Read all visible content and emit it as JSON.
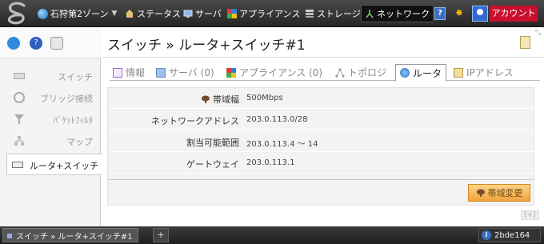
{
  "header": {
    "zone": "石狩第2ゾーン",
    "nav": [
      "ステータス",
      "サーバ",
      "アプライアンス",
      "ストレージ",
      "ネットワーク"
    ],
    "help": "?",
    "account": "アカウント"
  },
  "sidebar": {
    "items": [
      {
        "label": "スイッチ"
      },
      {
        "label": "ブリッジ接続"
      },
      {
        "label": "ﾊﾟｹｯﾄﾌｨﾙﾀ"
      },
      {
        "label": "マップ"
      },
      {
        "label": "ルータ+スイッチ"
      }
    ]
  },
  "main": {
    "title": "スイッチ » ルータ+スイッチ#1",
    "tabs": [
      {
        "label": "情報"
      },
      {
        "label": "サーバ (0)"
      },
      {
        "label": "アプライアンス (0)"
      },
      {
        "label": "トポロジ"
      },
      {
        "label": "ルータ"
      },
      {
        "label": "IPアドレス"
      }
    ],
    "rows": [
      {
        "label": "帯域幅",
        "value": "500Mbps"
      },
      {
        "label": "ネットワークアドレス",
        "value": "203.0.113.0/28"
      },
      {
        "label": "割当可能範囲",
        "value": "203.0.113.4 ～ 14"
      },
      {
        "label": "ゲートウェイ",
        "value": "203.0.113.1"
      }
    ],
    "change_bandwidth": "帯域変更",
    "expand": "[+]"
  },
  "statusbar": {
    "tab": "スイッチ » ルータ+スイッチ#1",
    "add": "+",
    "info": "2bde164"
  },
  "colors": {
    "accent": "#c8102e",
    "topbar": "#2f2f2f",
    "button": "#f1a33c"
  }
}
